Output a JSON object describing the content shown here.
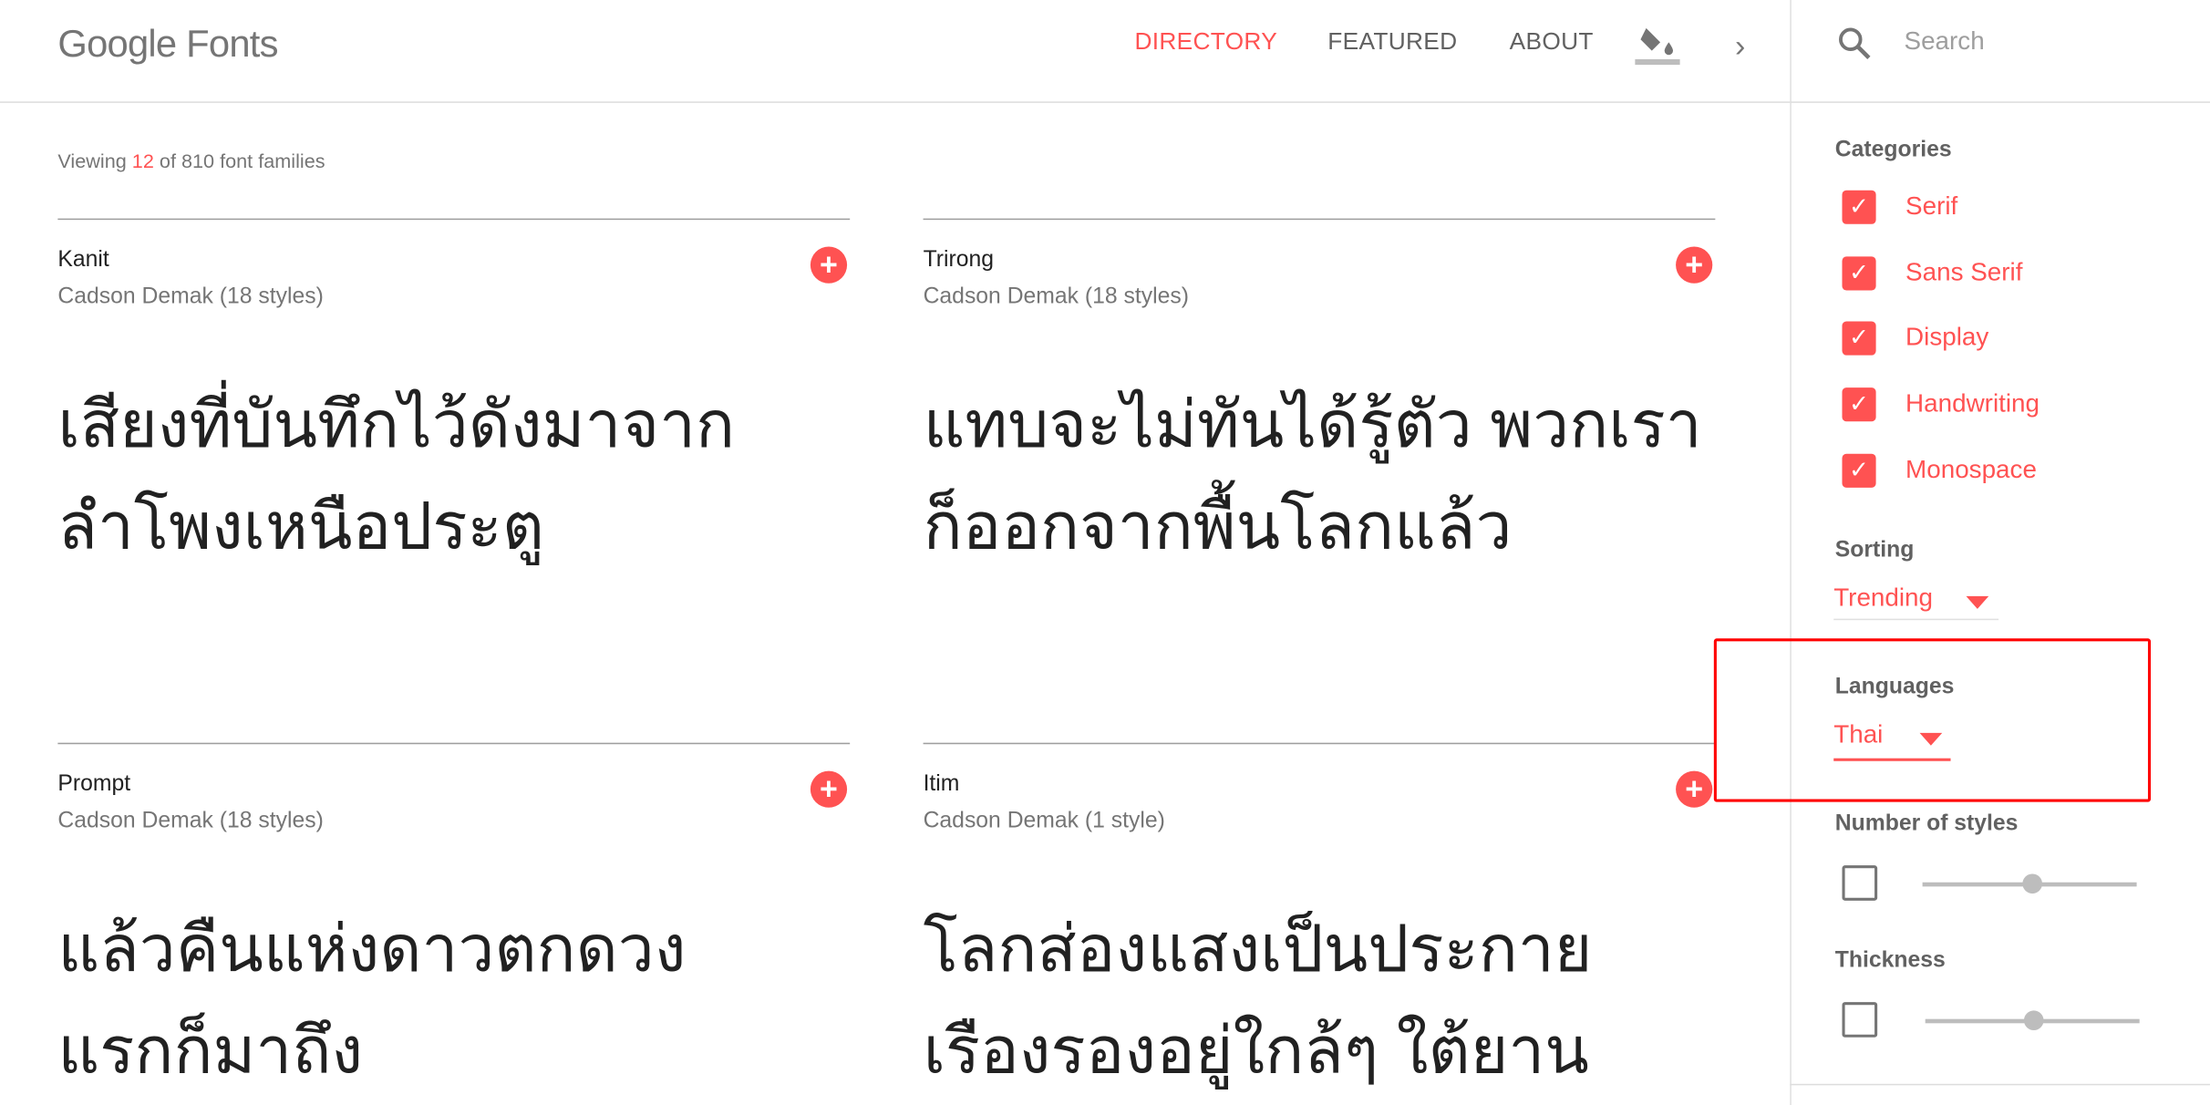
{
  "header": {
    "logo": "Google Fonts",
    "nav": [
      "DIRECTORY",
      "FEATURED",
      "ABOUT"
    ],
    "active_nav": "DIRECTORY",
    "search_placeholder": "Search",
    "accent": "#ff5252"
  },
  "main": {
    "viewing_prefix": "Viewing ",
    "viewing_count": "12",
    "viewing_suffix": " of 810 font families",
    "cards": [
      {
        "name": "Kanit",
        "author": "Cadson Demak (18 styles)",
        "sample1": "เสียงที่บันทึกไว้ดังมาจาก",
        "sample2": "ลำโพงเหนือประตู"
      },
      {
        "name": "Trirong",
        "author": "Cadson Demak (18 styles)",
        "sample1": "แทบจะไม่ทันได้รู้ตัว พวกเรา",
        "sample2": "ก็ออกจากพื้นโลกแล้ว"
      },
      {
        "name": "Prompt",
        "author": "Cadson Demak (18 styles)",
        "sample1": "แล้วคืนแห่งดาวตกดวง",
        "sample2": "แรกก็มาถึง"
      },
      {
        "name": "Itim",
        "author": "Cadson Demak (1 style)",
        "sample1": "โลกส่องแสงเป็นประกาย",
        "sample2": "เรืองรองอยู่ใกล้ๆ ใต้ยาน"
      }
    ]
  },
  "sidebar": {
    "categories_label": "Categories",
    "categories": [
      {
        "label": "Serif",
        "checked": true
      },
      {
        "label": "Sans Serif",
        "checked": true
      },
      {
        "label": "Display",
        "checked": true
      },
      {
        "label": "Handwriting",
        "checked": true
      },
      {
        "label": "Monospace",
        "checked": true
      }
    ],
    "sorting_label": "Sorting",
    "sorting_value": "Trending",
    "languages_label": "Languages",
    "languages_value": "Thai",
    "styles_label": "Number of styles",
    "styles_enabled": false,
    "thickness_label": "Thickness",
    "thickness_enabled": false
  }
}
